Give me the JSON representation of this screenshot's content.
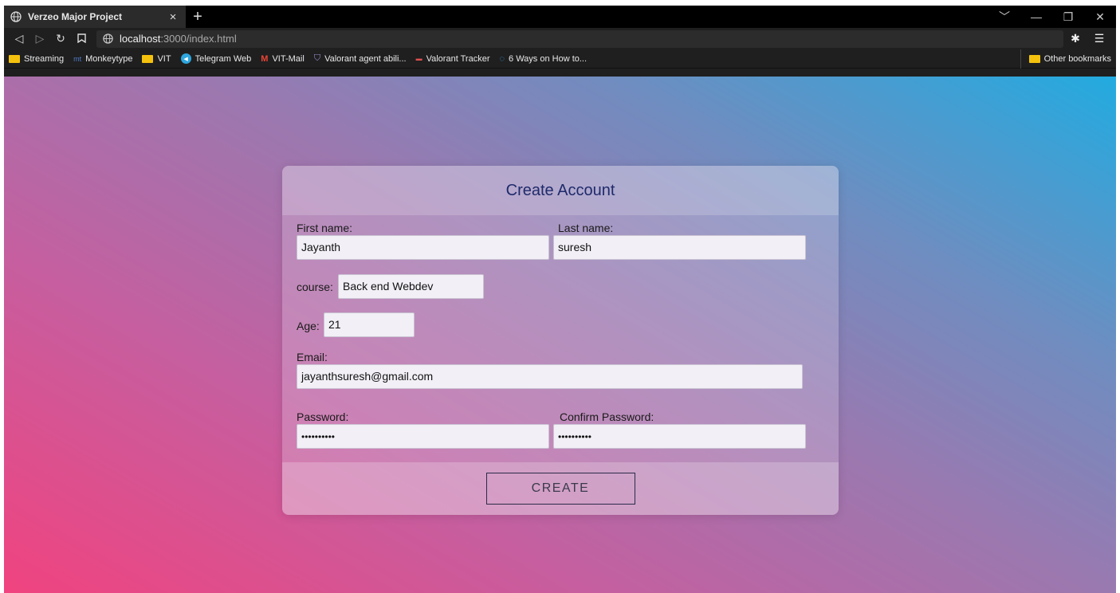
{
  "browser": {
    "tab_title": "Verzeo Major Project",
    "tab_close": "×",
    "new_tab": "+",
    "window_controls": [
      "﹀",
      "—",
      "❐",
      "✕"
    ],
    "url_host": "localhost",
    "url_path": ":3000/index.html",
    "bookmarks": [
      {
        "label": "Streaming",
        "icon": "folder-icon"
      },
      {
        "label": "Monkeytype",
        "icon": "monkeytype-icon",
        "glyph": "mt"
      },
      {
        "label": "VIT",
        "icon": "folder-icon"
      },
      {
        "label": "Telegram Web",
        "icon": "telegram-icon",
        "glyph": "◀"
      },
      {
        "label": "VIT-Mail",
        "icon": "gmail-icon",
        "glyph": "M"
      },
      {
        "label": "Valorant agent abili...",
        "icon": "shield-icon",
        "glyph": "⛉"
      },
      {
        "label": "Valorant Tracker",
        "icon": "tracker-icon",
        "glyph": "▬"
      },
      {
        "label": "6 Ways on How to...",
        "icon": "edge-icon",
        "glyph": "◌"
      }
    ],
    "other_bookmarks": "Other bookmarks"
  },
  "form": {
    "title": "Create Account",
    "first_name_label": "First name:",
    "first_name_value": "Jayanth",
    "last_name_label": "Last name:",
    "last_name_value": "suresh",
    "course_label": "course:",
    "course_value": "Back end Webdev",
    "age_label": "Age:",
    "age_value": "21",
    "email_label": "Email:",
    "email_value": "jayanthsuresh@gmail.com",
    "password_label": "Password:",
    "password_value": "••••••••••",
    "confirm_password_label": "Confirm Password:",
    "confirm_password_value": "••••••••••",
    "submit_label": "CREATE"
  },
  "colors": {
    "gradient_start": "#f0437f",
    "gradient_end": "#22abe0",
    "title_text": "#1f2a6b"
  }
}
